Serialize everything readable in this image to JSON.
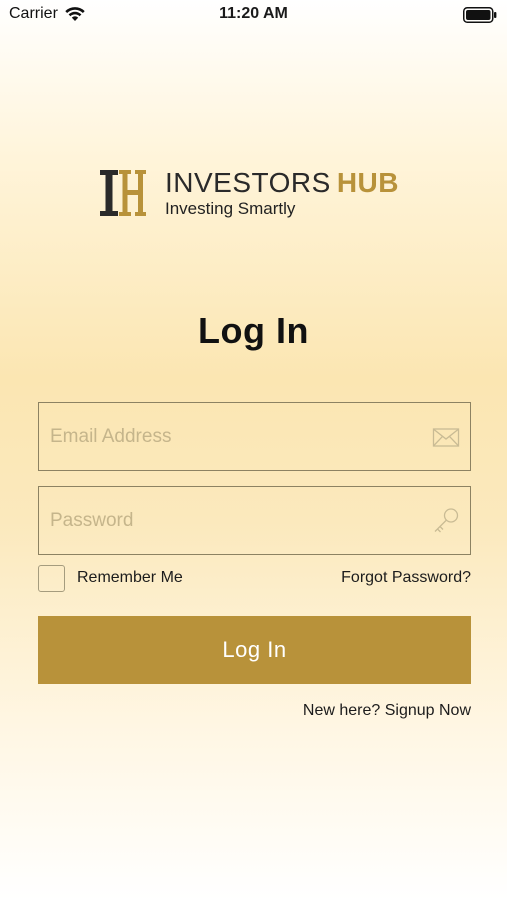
{
  "status_bar": {
    "carrier": "Carrier",
    "time": "11:20 AM",
    "wifi_icon": "wifi-icon",
    "battery_icon": "battery-icon"
  },
  "logo": {
    "mark_letters": "IH",
    "title_main": "INVESTORS",
    "title_accent": "HUB",
    "tagline": "Investing Smartly"
  },
  "colors": {
    "accent": "#b8923a",
    "dark": "#2a2a2a",
    "field_border": "#8c8262",
    "placeholder": "#c5b58b"
  },
  "page": {
    "title": "Log In"
  },
  "form": {
    "email": {
      "value": "",
      "placeholder": "Email Address",
      "icon": "envelope-icon"
    },
    "password": {
      "value": "",
      "placeholder": "Password",
      "icon": "key-icon"
    },
    "remember_label": "Remember Me",
    "remember_checked": false,
    "forgot_label": "Forgot Password?",
    "submit_label": "Log In",
    "signup_label": "New here? Signup Now"
  }
}
